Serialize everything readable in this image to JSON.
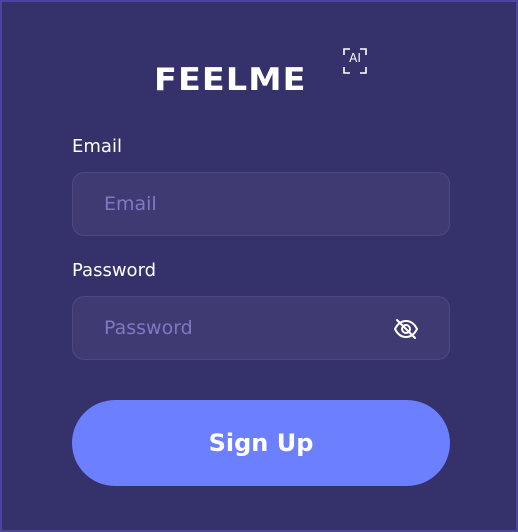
{
  "logo": {
    "wordmark": "FEELME",
    "badge": "AI"
  },
  "form": {
    "email": {
      "label": "Email",
      "placeholder": "Email",
      "value": ""
    },
    "password": {
      "label": "Password",
      "placeholder": "Password",
      "value": "",
      "visibility_icon": "eye-off-icon"
    },
    "submit_label": "Sign Up"
  },
  "colors": {
    "background": "#35326b",
    "input_background": "#3f3b72",
    "placeholder": "#7f79c4",
    "button": "#6b7fff",
    "text": "#ffffff"
  }
}
